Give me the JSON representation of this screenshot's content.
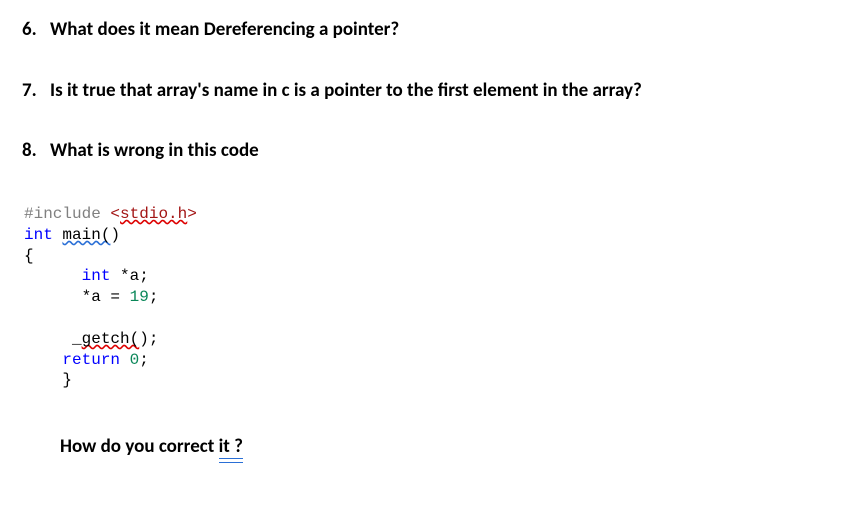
{
  "questions": [
    {
      "number": "6.",
      "text": "What does it mean Dereferencing a pointer?"
    },
    {
      "number": "7.",
      "text": "Is it true that array's name in c is a pointer to the first element in the array?"
    },
    {
      "number": "8.",
      "text": "What is wrong in this code"
    }
  ],
  "code": {
    "include_kw": "#include",
    "include_lt": "<",
    "include_target": "stdio.h",
    "include_gt": ">",
    "int_kw": "int",
    "main_name": "main(",
    "main_close": ")",
    "brace_open": "{",
    "line_decl_type": "int",
    "line_decl_rest": " *a;",
    "line_assign": "      *a = ",
    "line_assign_num": "19",
    "line_assign_end": ";",
    "getch_prefix": "     _",
    "getch_name": "getch(",
    "getch_end": ");",
    "return_kw": "return",
    "return_num": "0",
    "return_end": ";",
    "brace_close": "    }"
  },
  "followup": {
    "prefix": "How do you correct ",
    "word": "it ?"
  }
}
